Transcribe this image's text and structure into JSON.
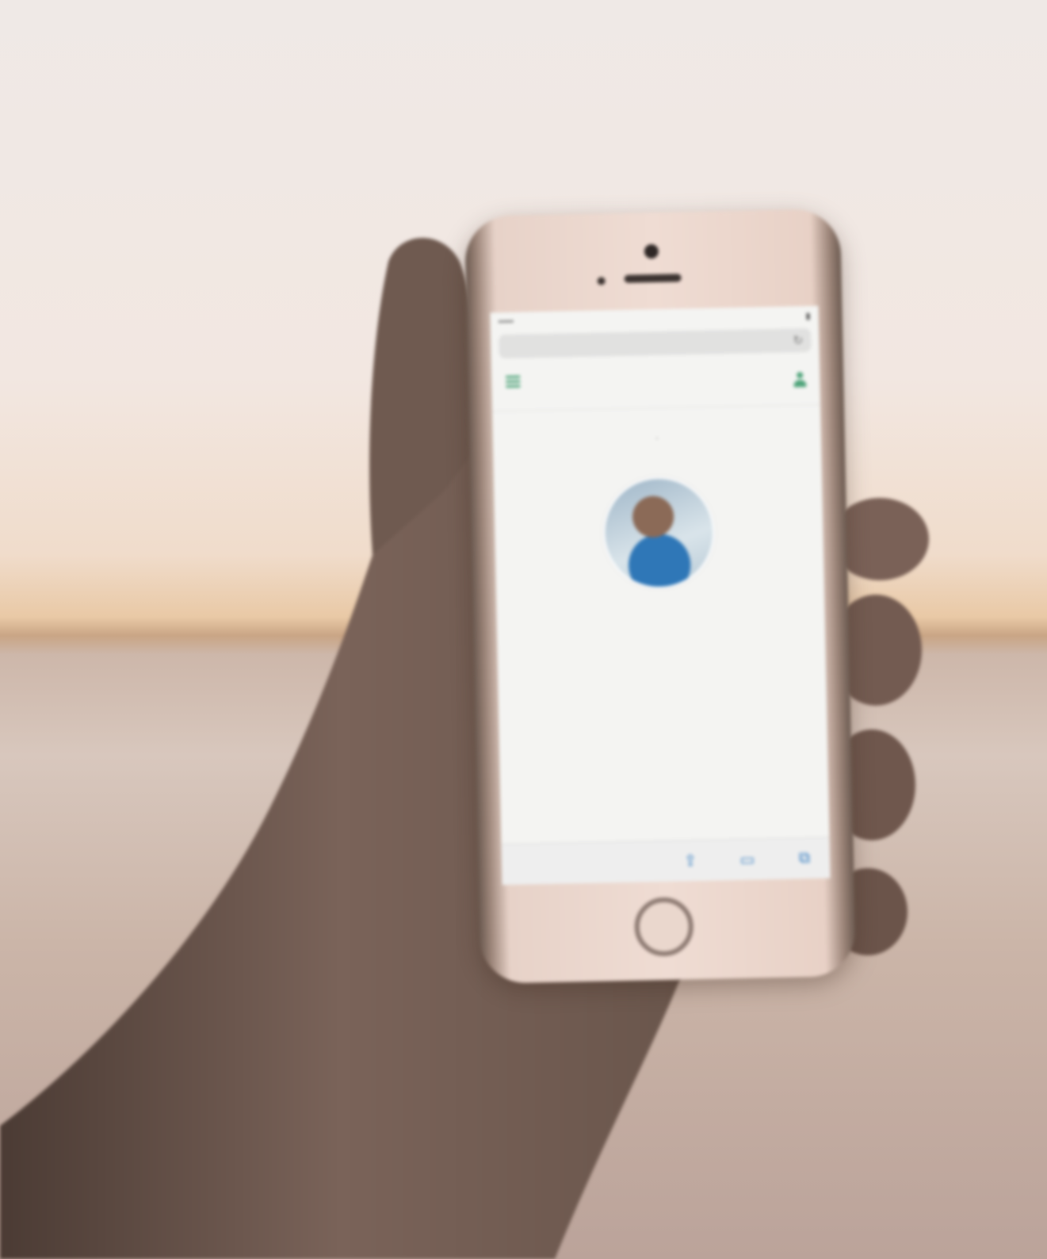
{
  "phone": {
    "url": "",
    "status_time": "",
    "site_logo_accent": "",
    "site_logo_main": "",
    "meta_left": "",
    "meta_right": "",
    "meta_sub": "",
    "person_name": "",
    "person_description": "",
    "share_text": "",
    "icons": {
      "menu": "hamburger-menu-icon",
      "user": "user-icon",
      "reload": "reload-icon",
      "share": "share-icon",
      "bookmarks": "book-icon",
      "tabs": "tabs-icon"
    }
  },
  "colors": {
    "accent": "#4fa47a",
    "sky": "#efe9e6",
    "horizon": "#e9c9a6",
    "water": "#cbb5a8"
  }
}
